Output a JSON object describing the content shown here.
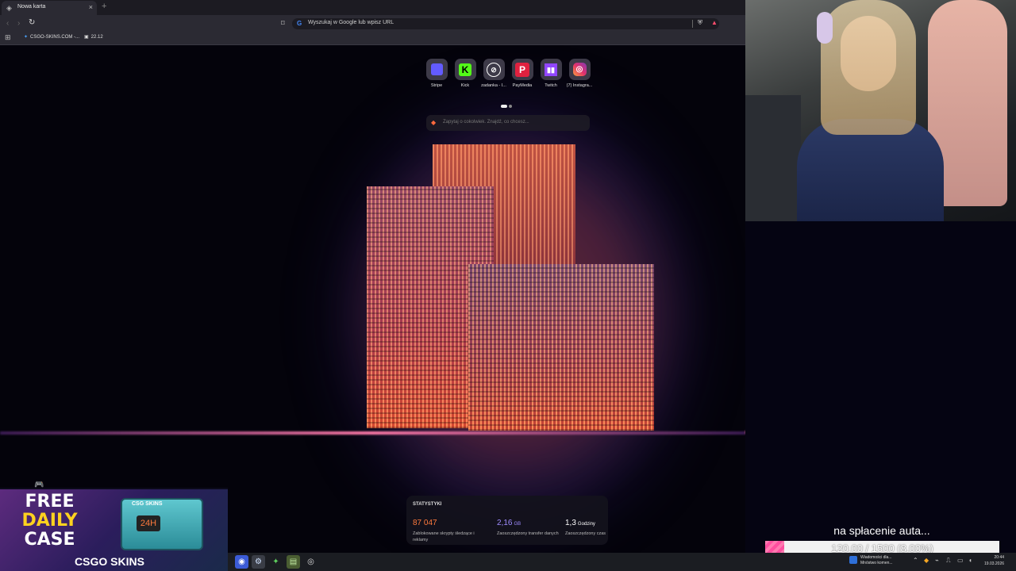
{
  "browser": {
    "tab_title": "Nowa karta",
    "address_placeholder": "Wyszukaj w Google lub wpisz URL",
    "bookmarks": [
      {
        "label": "CSGO-SKINS.COM -..."
      },
      {
        "label": "22.12"
      }
    ]
  },
  "ntp": {
    "shortcuts": [
      {
        "label": "Stripe",
        "color": "#635bff",
        "icon": "stripe-icon"
      },
      {
        "label": "Kick",
        "color": "#53fc18",
        "icon": "kick-icon"
      },
      {
        "label": "zadanka - I...",
        "color": "#ffffff",
        "icon": "zadanka-icon"
      },
      {
        "label": "PayMedia",
        "color": "#e0213f",
        "icon": "paymedia-icon"
      },
      {
        "label": "Twitch",
        "color": "#9146ff",
        "icon": "twitch-icon"
      },
      {
        "label": "(7) Instagra...",
        "color": "#e1306c",
        "icon": "instagram-icon"
      }
    ],
    "search_placeholder": "Zapytaj o cokolwiek. Znajdź, co chcesz...",
    "stats": {
      "heading": "STATYSTYKI",
      "items": [
        {
          "value": "87 047",
          "unit": "",
          "desc": "Zablokowane skrypty śledzące i reklamy",
          "color": "#ff7a3d"
        },
        {
          "value": "2,16",
          "unit": "GB",
          "desc": "Zaoszczędzony transfer danych",
          "color": "#9f8cff"
        },
        {
          "value": "1,3",
          "unit": "Godziny",
          "desc": "Zaoszczędzony czas",
          "color": "#ffffff"
        }
      ]
    }
  },
  "promo": {
    "line1": "FREE",
    "line2": "DAILY",
    "line3": "CASE",
    "brand": "CSGO SKINS",
    "badge": "24H",
    "case_label": "CSG SKINS"
  },
  "goal": {
    "title": "na spłacenie auta...",
    "progress_text": "120.00 / 1500 (8.00%)",
    "progress_fraction": 0.08
  },
  "taskbar": {
    "notification_title": "Wiadomości dla...",
    "notification_sub": "Mnóstwo komen...",
    "time": "20:44",
    "date": "19.03.2026"
  }
}
